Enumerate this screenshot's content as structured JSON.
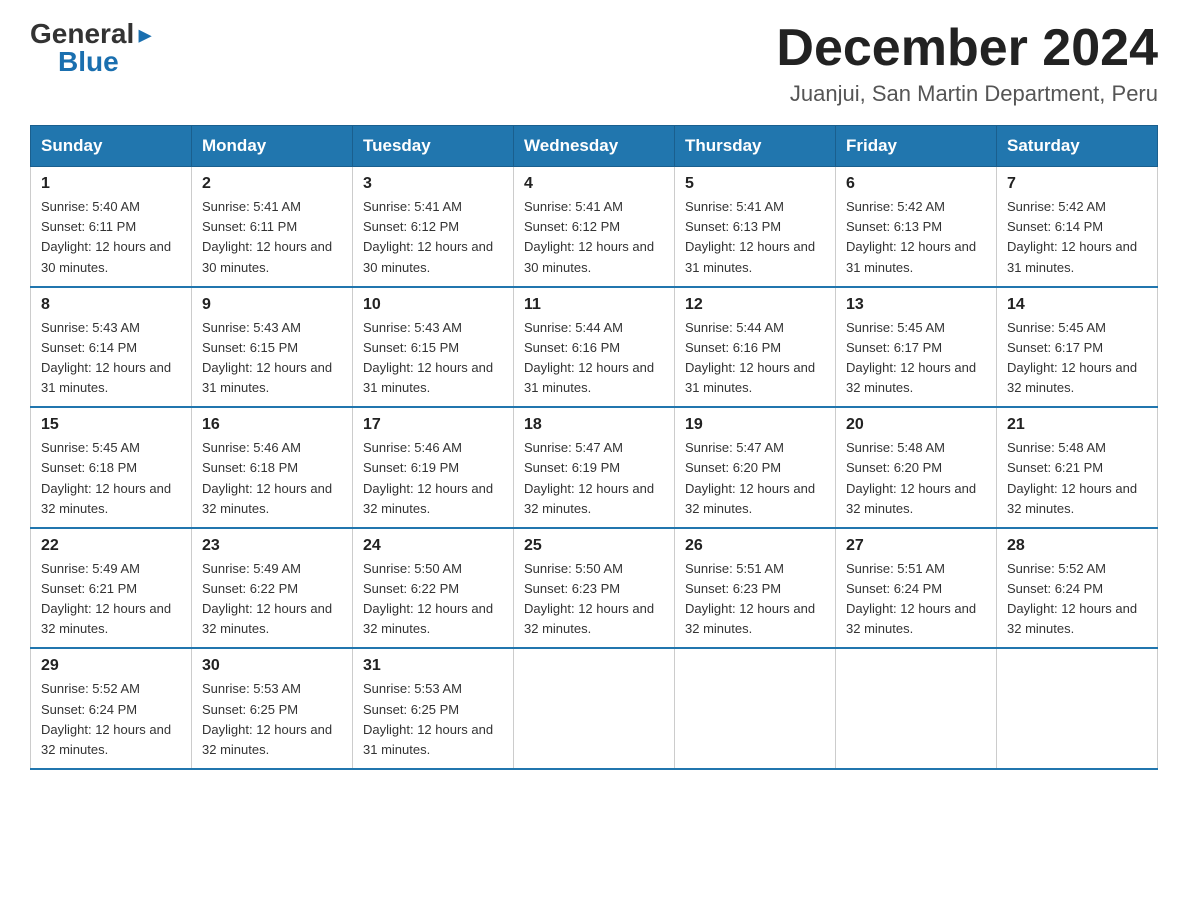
{
  "header": {
    "logo_general": "General",
    "logo_blue": "Blue",
    "month_title": "December 2024",
    "location": "Juanjui, San Martin Department, Peru"
  },
  "days_of_week": [
    "Sunday",
    "Monday",
    "Tuesday",
    "Wednesday",
    "Thursday",
    "Friday",
    "Saturday"
  ],
  "weeks": [
    [
      {
        "day": "1",
        "sunrise": "5:40 AM",
        "sunset": "6:11 PM",
        "daylight": "12 hours and 30 minutes."
      },
      {
        "day": "2",
        "sunrise": "5:41 AM",
        "sunset": "6:11 PM",
        "daylight": "12 hours and 30 minutes."
      },
      {
        "day": "3",
        "sunrise": "5:41 AM",
        "sunset": "6:12 PM",
        "daylight": "12 hours and 30 minutes."
      },
      {
        "day": "4",
        "sunrise": "5:41 AM",
        "sunset": "6:12 PM",
        "daylight": "12 hours and 30 minutes."
      },
      {
        "day": "5",
        "sunrise": "5:41 AM",
        "sunset": "6:13 PM",
        "daylight": "12 hours and 31 minutes."
      },
      {
        "day": "6",
        "sunrise": "5:42 AM",
        "sunset": "6:13 PM",
        "daylight": "12 hours and 31 minutes."
      },
      {
        "day": "7",
        "sunrise": "5:42 AM",
        "sunset": "6:14 PM",
        "daylight": "12 hours and 31 minutes."
      }
    ],
    [
      {
        "day": "8",
        "sunrise": "5:43 AM",
        "sunset": "6:14 PM",
        "daylight": "12 hours and 31 minutes."
      },
      {
        "day": "9",
        "sunrise": "5:43 AM",
        "sunset": "6:15 PM",
        "daylight": "12 hours and 31 minutes."
      },
      {
        "day": "10",
        "sunrise": "5:43 AM",
        "sunset": "6:15 PM",
        "daylight": "12 hours and 31 minutes."
      },
      {
        "day": "11",
        "sunrise": "5:44 AM",
        "sunset": "6:16 PM",
        "daylight": "12 hours and 31 minutes."
      },
      {
        "day": "12",
        "sunrise": "5:44 AM",
        "sunset": "6:16 PM",
        "daylight": "12 hours and 31 minutes."
      },
      {
        "day": "13",
        "sunrise": "5:45 AM",
        "sunset": "6:17 PM",
        "daylight": "12 hours and 32 minutes."
      },
      {
        "day": "14",
        "sunrise": "5:45 AM",
        "sunset": "6:17 PM",
        "daylight": "12 hours and 32 minutes."
      }
    ],
    [
      {
        "day": "15",
        "sunrise": "5:45 AM",
        "sunset": "6:18 PM",
        "daylight": "12 hours and 32 minutes."
      },
      {
        "day": "16",
        "sunrise": "5:46 AM",
        "sunset": "6:18 PM",
        "daylight": "12 hours and 32 minutes."
      },
      {
        "day": "17",
        "sunrise": "5:46 AM",
        "sunset": "6:19 PM",
        "daylight": "12 hours and 32 minutes."
      },
      {
        "day": "18",
        "sunrise": "5:47 AM",
        "sunset": "6:19 PM",
        "daylight": "12 hours and 32 minutes."
      },
      {
        "day": "19",
        "sunrise": "5:47 AM",
        "sunset": "6:20 PM",
        "daylight": "12 hours and 32 minutes."
      },
      {
        "day": "20",
        "sunrise": "5:48 AM",
        "sunset": "6:20 PM",
        "daylight": "12 hours and 32 minutes."
      },
      {
        "day": "21",
        "sunrise": "5:48 AM",
        "sunset": "6:21 PM",
        "daylight": "12 hours and 32 minutes."
      }
    ],
    [
      {
        "day": "22",
        "sunrise": "5:49 AM",
        "sunset": "6:21 PM",
        "daylight": "12 hours and 32 minutes."
      },
      {
        "day": "23",
        "sunrise": "5:49 AM",
        "sunset": "6:22 PM",
        "daylight": "12 hours and 32 minutes."
      },
      {
        "day": "24",
        "sunrise": "5:50 AM",
        "sunset": "6:22 PM",
        "daylight": "12 hours and 32 minutes."
      },
      {
        "day": "25",
        "sunrise": "5:50 AM",
        "sunset": "6:23 PM",
        "daylight": "12 hours and 32 minutes."
      },
      {
        "day": "26",
        "sunrise": "5:51 AM",
        "sunset": "6:23 PM",
        "daylight": "12 hours and 32 minutes."
      },
      {
        "day": "27",
        "sunrise": "5:51 AM",
        "sunset": "6:24 PM",
        "daylight": "12 hours and 32 minutes."
      },
      {
        "day": "28",
        "sunrise": "5:52 AM",
        "sunset": "6:24 PM",
        "daylight": "12 hours and 32 minutes."
      }
    ],
    [
      {
        "day": "29",
        "sunrise": "5:52 AM",
        "sunset": "6:24 PM",
        "daylight": "12 hours and 32 minutes."
      },
      {
        "day": "30",
        "sunrise": "5:53 AM",
        "sunset": "6:25 PM",
        "daylight": "12 hours and 32 minutes."
      },
      {
        "day": "31",
        "sunrise": "5:53 AM",
        "sunset": "6:25 PM",
        "daylight": "12 hours and 31 minutes."
      },
      null,
      null,
      null,
      null
    ]
  ]
}
